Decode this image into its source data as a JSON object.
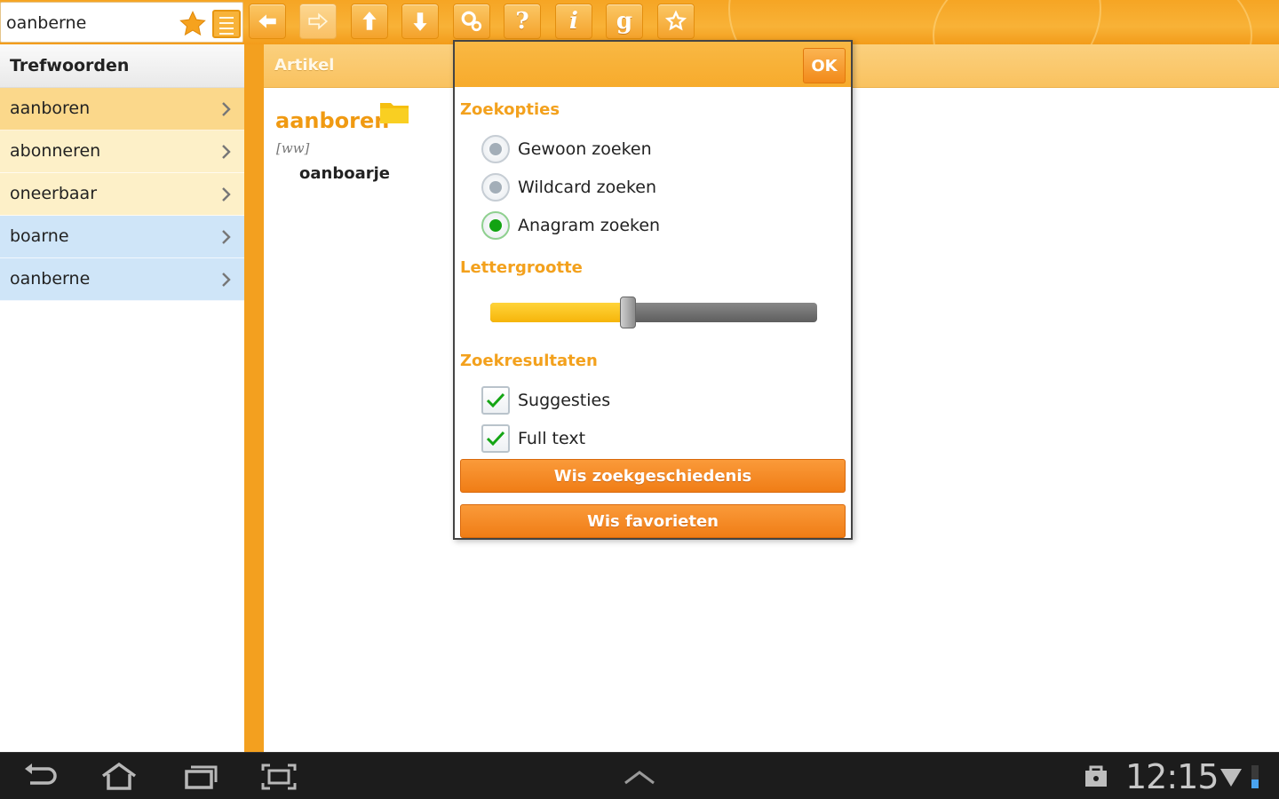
{
  "search": {
    "value": "oanberne"
  },
  "colors": {
    "accent": "#f3a01f",
    "selected_item": "#fbd88b",
    "history_item": "#cfe5f8",
    "radio_checked": "#12a312"
  },
  "toolbar": {
    "buttons": [
      {
        "name": "back",
        "icon": "arrow-left-icon",
        "enabled": true
      },
      {
        "name": "forward",
        "icon": "arrow-right-icon",
        "enabled": false
      },
      {
        "name": "up",
        "icon": "arrow-up-icon",
        "enabled": true
      },
      {
        "name": "down",
        "icon": "arrow-down-icon",
        "enabled": true
      },
      {
        "name": "search-settings",
        "icon": "magnifier-gear-icon",
        "enabled": true
      },
      {
        "name": "help",
        "icon": "question-icon",
        "label": "?",
        "enabled": true
      },
      {
        "name": "info",
        "icon": "info-icon",
        "label": "i",
        "enabled": true
      },
      {
        "name": "grammar",
        "icon": "g-icon",
        "label": "g",
        "enabled": true
      },
      {
        "name": "favorites",
        "icon": "star-icon",
        "enabled": true
      }
    ]
  },
  "sidebar": {
    "title": "Trefwoorden",
    "items": [
      {
        "label": "aanboren",
        "state": "selected"
      },
      {
        "label": "abonneren",
        "state": "yellow"
      },
      {
        "label": "oneerbaar",
        "state": "yellow"
      },
      {
        "label": "boarne",
        "state": "blue"
      },
      {
        "label": "oanberne",
        "state": "blue"
      }
    ]
  },
  "article": {
    "title": "Artikel",
    "headword": "aanboren",
    "pos": "[ww]",
    "translation": "oanboarje"
  },
  "dialog": {
    "ok_label": "OK",
    "search_options_title": "Zoekopties",
    "options": [
      {
        "label": "Gewoon zoeken",
        "checked": false
      },
      {
        "label": "Wildcard zoeken",
        "checked": false
      },
      {
        "label": "Anagram zoeken",
        "checked": true
      }
    ],
    "font_size_title": "Lettergrootte",
    "font_size_fraction": 0.42,
    "results_title": "Zoekresultaten",
    "result_options": [
      {
        "label": "Suggesties",
        "checked": true
      },
      {
        "label": "Full text",
        "checked": true
      }
    ],
    "clear_history_label": "Wis zoekgeschiedenis",
    "clear_favorites_label": "Wis favorieten"
  },
  "statusbar": {
    "time": "12:15"
  }
}
